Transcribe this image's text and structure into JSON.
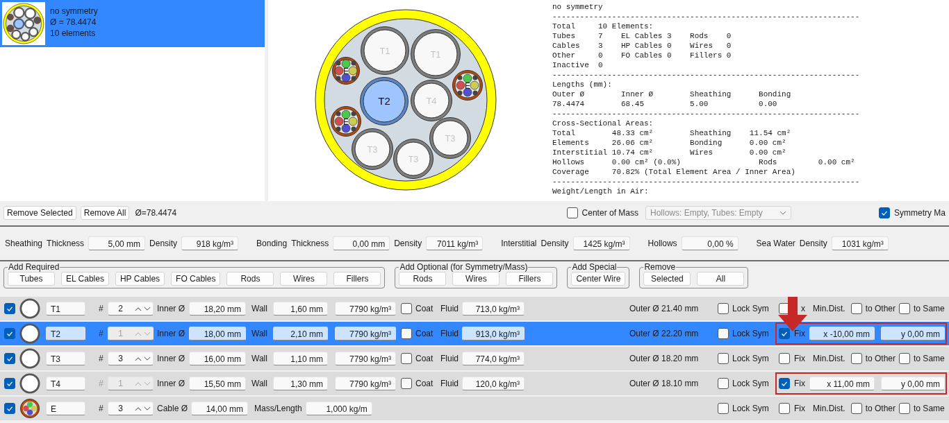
{
  "designs": [
    {
      "title": "no symmetry",
      "diameter": "Ø = 78.4474",
      "count": "10 elements",
      "selected": true
    }
  ],
  "cross_section": {
    "parts": [
      {
        "label": "T1",
        "kind": "tube",
        "selected": false
      },
      {
        "label": "T1",
        "kind": "tube",
        "selected": false
      },
      {
        "label": "E",
        "kind": "cable",
        "selected": false
      },
      {
        "label": "T2",
        "kind": "tube",
        "selected": true
      },
      {
        "label": "T4",
        "kind": "tube",
        "selected": false
      },
      {
        "label": "E",
        "kind": "cable",
        "selected": false
      },
      {
        "label": "E",
        "kind": "cable",
        "selected": false
      },
      {
        "label": "T3",
        "kind": "tube",
        "selected": false
      },
      {
        "label": "T3",
        "kind": "tube",
        "selected": false
      },
      {
        "label": "T3",
        "kind": "tube",
        "selected": false
      }
    ]
  },
  "report": {
    "lines": [
      "no symmetry",
      "-------------------------------------------------------------------",
      "Total     10 Elements:",
      "Tubes     7    EL Cables 3    Rods    0",
      "Cables    3    HP Cables 0    Wires   0",
      "Other     0    FO Cables 0    Fillers 0",
      "Inactive  0",
      "-------------------------------------------------------------------",
      "Lengths (mm):",
      "Outer Ø        Inner Ø        Sheathing      Bonding",
      "78.4474        68.45          5.00           0.00",
      "-------------------------------------------------------------------",
      "Cross-Sectional Areas:",
      "Total        48.33 cm²        Sheathing    11.54 cm²",
      "Elements     26.06 cm²        Bonding      0.00 cm²",
      "Interstitial 10.74 cm²        Wires        0.00 cm²",
      "Hollows      0.00 cm² (0.0%)                 Rods         0.00 cm²",
      "Coverage     70.82% (Total Element Area / Inner Area)",
      "-------------------------------------------------------------------",
      "Weight/Length in Air:"
    ]
  },
  "toolbar": {
    "buttons": [
      "Remove Selected",
      "Remove All"
    ],
    "diameter": "Ø=78.4474",
    "center_of_mass": {
      "label": "Center of Mass",
      "checked": false
    },
    "fill_mode": {
      "value": "Hollows: Empty, Tubes: Empty",
      "disabled": true
    },
    "symmetry": {
      "label": "Symmetry Ma",
      "checked": true
    }
  },
  "materials": [
    {
      "name": "Sheathing",
      "fields": [
        {
          "label": "Thickness",
          "value": "5,00 mm"
        },
        {
          "label": "Density",
          "value": "918 kg/m³"
        }
      ]
    },
    {
      "name": "Bonding",
      "fields": [
        {
          "label": "Thickness",
          "value": "0,00 mm"
        },
        {
          "label": "Density",
          "value": "7011 kg/m³"
        }
      ]
    },
    {
      "name": "Interstitial",
      "fields": [
        {
          "label": "Density",
          "value": "1425 kg/m³"
        }
      ]
    },
    {
      "name": "Hollows",
      "fields": [
        {
          "value": "0,00 %"
        }
      ]
    },
    {
      "name": "Sea Water",
      "fields": [
        {
          "label": "Density",
          "value": "1031 kg/m³"
        }
      ]
    }
  ],
  "groups": [
    {
      "title": "Add Required",
      "buttons": [
        "Tubes",
        "EL Cables",
        "HP Cables",
        "FO Cables",
        "Rods",
        "Wires",
        "Fillers"
      ]
    },
    {
      "title": "Add Optional (for Symmetry/Mass)",
      "buttons": [
        "Rods",
        "Wires",
        "Fillers"
      ]
    },
    {
      "title": "Add Special",
      "buttons": [
        "Center Wire"
      ]
    },
    {
      "title": "Remove",
      "buttons": [
        "Selected",
        "All"
      ]
    }
  ],
  "rows": [
    {
      "kind": "tube",
      "selected": false,
      "active": true,
      "name": "T1",
      "hash": "#",
      "count": "2",
      "count_disabled": false,
      "inner_label": "Inner Ø",
      "inner": "18,20 mm",
      "wall_label": "Wall",
      "wall": "1,60 mm",
      "density": "7790 kg/m³",
      "coat": {
        "label": "Coat",
        "checked": false
      },
      "fluid_label": "Fluid",
      "fluid": "713,0 kg/m³",
      "outer": "Outer Ø 21.40 mm",
      "lock_sym": {
        "label": "Lock Sym",
        "checked": false
      },
      "fix": {
        "label": "x",
        "checked": false
      },
      "highlighted": false,
      "min_dist": "Min.Dist.",
      "to_other": {
        "label": "to Other",
        "checked": false
      },
      "to_same": {
        "label": "to Same",
        "checked": false
      }
    },
    {
      "kind": "tube",
      "selected": true,
      "active": true,
      "name": "T2",
      "hash": "#",
      "count": "1",
      "count_disabled": true,
      "inner_label": "Inner Ø",
      "inner": "18,00 mm",
      "wall_label": "Wall",
      "wall": "2,10 mm",
      "density": "7790 kg/m³",
      "coat": {
        "label": "Coat",
        "checked": false
      },
      "fluid_label": "Fluid",
      "fluid": "913,0 kg/m³",
      "outer": "Outer Ø 22.20 mm",
      "lock_sym": {
        "label": "Lock Sym",
        "checked": false
      },
      "fix": {
        "label": "Fix",
        "checked": true
      },
      "highlighted": true,
      "x": "x -10,00 mm",
      "y": "y 0,00 mm"
    },
    {
      "kind": "tube",
      "selected": false,
      "active": true,
      "name": "T3",
      "hash": "#",
      "count": "3",
      "count_disabled": false,
      "inner_label": "Inner Ø",
      "inner": "16,00 mm",
      "wall_label": "Wall",
      "wall": "1,10 mm",
      "density": "7790 kg/m³",
      "coat": {
        "label": "Coat",
        "checked": false
      },
      "fluid_label": "Fluid",
      "fluid": "774,0 kg/m³",
      "outer": "Outer Ø 18.20 mm",
      "lock_sym": {
        "label": "Lock Sym",
        "checked": false
      },
      "fix": {
        "label": "Fix",
        "checked": false
      },
      "highlighted": false,
      "min_dist": "Min.Dist.",
      "to_other": {
        "label": "to Other",
        "checked": false
      },
      "to_same": {
        "label": "to Same",
        "checked": false
      }
    },
    {
      "kind": "tube",
      "selected": false,
      "active": true,
      "name": "T4",
      "hash": "#",
      "count": "1",
      "count_disabled": true,
      "inner_label": "Inner Ø",
      "inner": "15,50 mm",
      "wall_label": "Wall",
      "wall": "1,30 mm",
      "density": "7790 kg/m³",
      "coat": {
        "label": "Coat",
        "checked": false
      },
      "fluid_label": "Fluid",
      "fluid": "120,0 kg/m³",
      "outer": "Outer Ø 18.10 mm",
      "lock_sym": {
        "label": "Lock Sym",
        "checked": false
      },
      "fix": {
        "label": "Fix",
        "checked": true
      },
      "highlighted": true,
      "x": "x 11,00 mm",
      "y": "y 0,00 mm"
    },
    {
      "kind": "cable",
      "selected": false,
      "active": true,
      "name": "E",
      "hash": "#",
      "count": "3",
      "count_disabled": false,
      "cable_label": "Cable Ø",
      "cable": "14,00 mm",
      "mass_label": "Mass/Length",
      "mass": "1,000 kg/m",
      "lock_sym": {
        "label": "Lock Sym",
        "checked": false
      },
      "fix": {
        "label": "Fix",
        "checked": false
      },
      "highlighted": false,
      "min_dist": "Min.Dist.",
      "to_other": {
        "label": "to Other",
        "checked": false
      },
      "to_same": {
        "label": "to Same",
        "checked": false
      }
    }
  ]
}
